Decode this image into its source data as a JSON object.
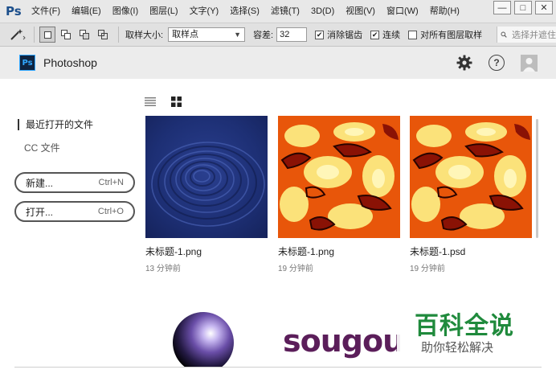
{
  "menubar": {
    "logo": "Ps",
    "items": [
      "文件(F)",
      "编辑(E)",
      "图像(I)",
      "图层(L)",
      "文字(Y)",
      "选择(S)",
      "滤镜(T)",
      "3D(D)",
      "视图(V)",
      "窗口(W)",
      "帮助(H)"
    ],
    "window_controls": {
      "minimize": "—",
      "restore": "□",
      "close": "✕"
    }
  },
  "optbar": {
    "tool_icon": "magic-wand-icon",
    "sample_size_label": "取样大小:",
    "sample_size_value": "取样点",
    "tolerance_label": "容差:",
    "tolerance_value": "32",
    "antialias_label": "消除锯齿",
    "contiguous_label": "连续",
    "all_layers_label": "对所有图层取样",
    "search_placeholder": "选择并遮住"
  },
  "header": {
    "badge": "Ps",
    "app_name": "Photoshop"
  },
  "sidebar": {
    "recent_label": "最近打开的文件",
    "cc_label": "CC 文件",
    "new_label": "新建...",
    "new_shortcut": "Ctrl+N",
    "open_label": "打开...",
    "open_shortcut": "Ctrl+O"
  },
  "files": [
    {
      "name": "未标题-1.png",
      "time": "13 分钟前"
    },
    {
      "name": "未标题-1.png",
      "time": "19 分钟前"
    },
    {
      "name": "未标题-1.psd",
      "time": "19 分钟前"
    }
  ],
  "thumbs_row2": {
    "sougou_text": "sougou"
  },
  "watermark": {
    "title": "百科全说",
    "subtitle": "助你轻松解决"
  },
  "colors": {
    "ps_blue": "#31a8ff",
    "accent_green": "#1f8a3c",
    "sougou_purple": "#5b1e5a"
  }
}
